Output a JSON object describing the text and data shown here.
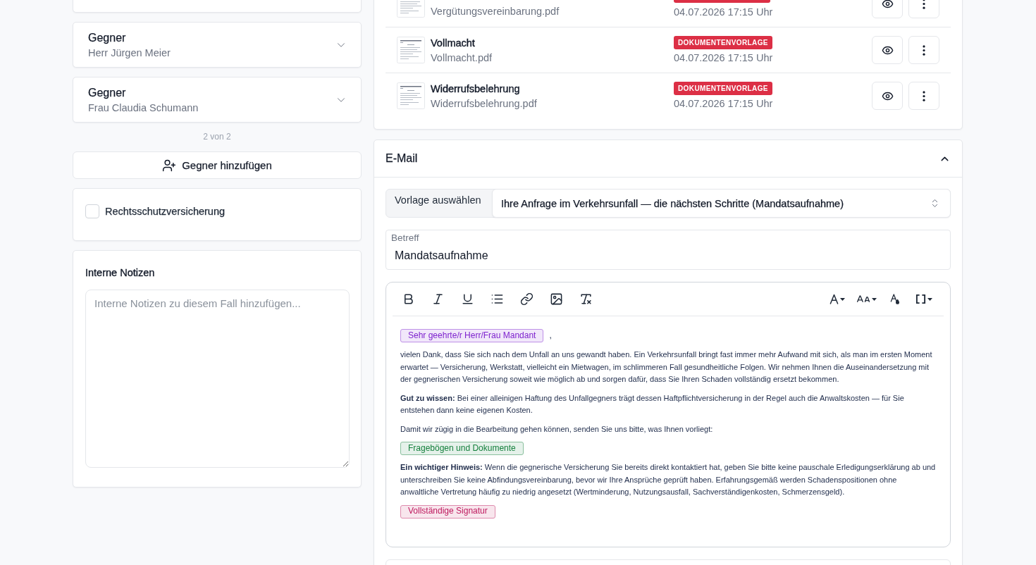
{
  "opponents": [
    {
      "label": "Gegner",
      "name": "Herr Jürgen Meier",
      "expanded": false
    },
    {
      "label": "Gegner",
      "name": "Frau Claudia Schumann",
      "expanded": false
    }
  ],
  "pager": "2 von 2",
  "add_button": "Gegner hinzufügen",
  "insurance": {
    "label": "Rechtsschutzversicherung",
    "checked": false
  },
  "notes": {
    "title": "Interne Notizen",
    "placeholder": "Interne Notizen zu diesem Fall hinzufügen..."
  },
  "documents": [
    {
      "file": "Vergütungsvereinbarung.pdf",
      "template": true,
      "date": "04.07.2026 17:15 Uhr"
    },
    {
      "title": "Vollmacht",
      "file": "Vollmacht.pdf",
      "template": true,
      "tag": "DOKUMENTENVORLAGE",
      "date": "04.07.2026 17:15 Uhr"
    },
    {
      "title": "Widerrufsbelehrung",
      "file": "Widerrufsbelehrung.pdf",
      "template": true,
      "tag": "DOKUMENTENVORLAGE",
      "date": "04.07.2026 17:15 Uhr"
    }
  ],
  "email": {
    "title": "E-Mail",
    "expanded": true,
    "template": {
      "label": "Vorlage auswählen",
      "value": "Ihre Anfrage im Verkehrsunfall — die nächsten Schritte (Mandatsaufnahme)"
    },
    "subject": {
      "label": "Betreff",
      "value": "Mandatsaufnahme"
    },
    "body": [
      {
        "kind": "chip",
        "text": "Sehr geehrte/r Herr/Frau Mandant",
        "color": "#7e22ce",
        "suffix": ","
      },
      {
        "kind": "paragraph",
        "text": "vielen Dank, dass Sie sich nach dem Unfall an uns gewandt haben. Ein Verkehrsunfall bringt fast immer mehr Aufwand mit sich, als man im ersten Moment erwartet — Versicherung, Werkstatt, vielleicht ein Mietwagen, im schlimmeren Fall gesundheitliche Folgen. Wir nehmen Ihnen die Auseinandersetzung mit der gegnerischen Versicherung soweit wie möglich ab und sorgen dafür, dass Sie Ihren Schaden vollständig ersetzt bekommen."
      },
      {
        "kind": "paragraph",
        "text": "**Gut zu wissen:** Bei einer alleinigen Haftung des Unfallgegners trägt dessen Haftpflichtversicherung in der Regel auch die Anwaltskosten — für Sie entstehen dann keine eigenen Kosten."
      },
      {
        "kind": "paragraph",
        "text": "Damit wir zügig in die Bearbeitung gehen können, senden Sie uns bitte, was Ihnen vorliegt:"
      },
      {
        "kind": "chip",
        "text": "Fragebögen und Dokumente",
        "color": "#15803d"
      },
      {
        "kind": "paragraph",
        "text": "**Ein wichtiger Hinweis:** Wenn die gegnerische Versicherung Sie bereits direkt kontaktiert hat, geben Sie bitte keine pauschale Erledigungserklärung ab und unterschreiben Sie keine Abfindungsvereinbarung, bevor wir Ihre Ansprüche geprüft haben. Erfahrungsgemäß werden Schadenspositionen ohne anwaltliche Vertretung häufig zu niedrig angesetzt (Wertminderung, Nutzungsausfall, Sachverständigenkosten, Schmerzensgeld)."
      },
      {
        "kind": "chip",
        "text": "Vollständige Signatur",
        "color": "#be185d"
      }
    ]
  }
}
